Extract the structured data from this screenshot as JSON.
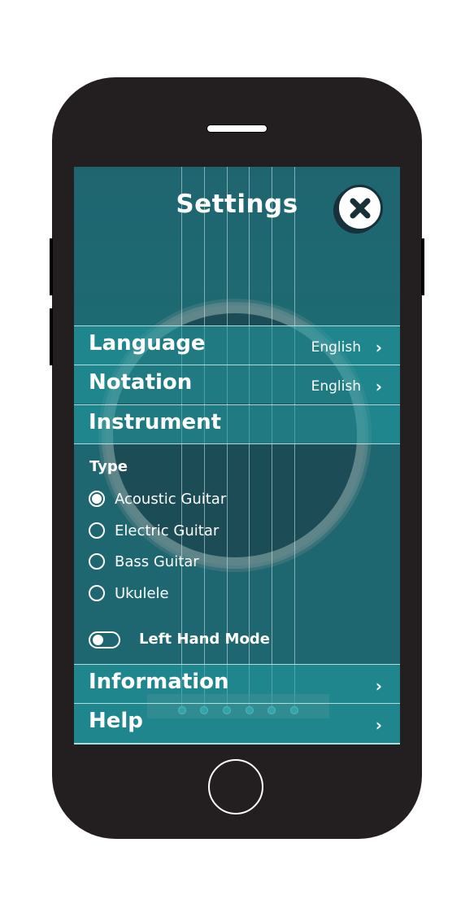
{
  "header": {
    "title": "Settings",
    "close_icon": "close-x-icon"
  },
  "menu": {
    "language": {
      "label": "Language",
      "value": "English"
    },
    "notation": {
      "label": "Notation",
      "value": "English"
    },
    "instrument": {
      "label": "Instrument"
    },
    "information": {
      "label": "Information"
    },
    "help": {
      "label": "Help"
    }
  },
  "instrument": {
    "type_label": "Type",
    "options": [
      {
        "label": "Acoustic Guitar",
        "selected": true
      },
      {
        "label": "Electric Guitar",
        "selected": false
      },
      {
        "label": "Bass Guitar",
        "selected": false
      },
      {
        "label": "Ukulele",
        "selected": false
      }
    ],
    "left_hand_mode": {
      "label": "Left Hand Mode",
      "enabled": false
    }
  },
  "colors": {
    "screen_bg": "#1e6770",
    "row_bg": "#22a0a5",
    "phone_body": "#231f20",
    "close_border": "#17303a"
  }
}
